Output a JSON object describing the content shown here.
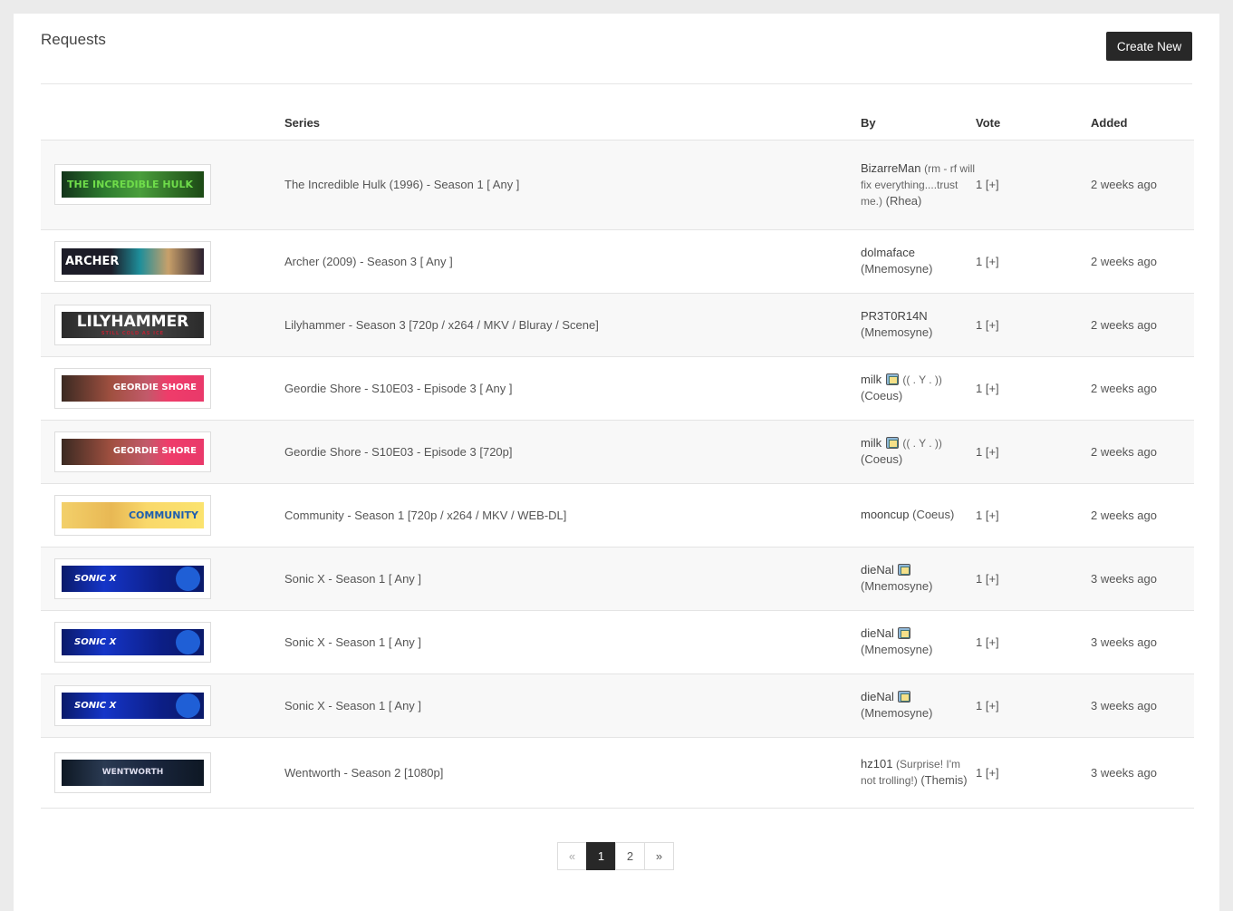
{
  "page": {
    "title": "Requests",
    "create_label": "Create New"
  },
  "table": {
    "headers": [
      "",
      "Series",
      "By",
      "Vote",
      "Added"
    ],
    "rows": [
      {
        "banner": "THE INCREDIBLE HULK",
        "banner_class": "b-hulk",
        "series": "The Incredible Hulk (1996) - Season 1 [ Any ]",
        "user": "BizarreMan",
        "note": "(rm - rf will fix everything....trust me.)",
        "tag": "(Rhea)",
        "tv": false,
        "vote": "1 [+]",
        "added": "2 weeks ago"
      },
      {
        "banner": "ARCHER",
        "banner_class": "b-archer",
        "series": "Archer (2009) - Season 3 [ Any ]",
        "user": "dolmaface",
        "note": "",
        "tag": "(Mnemosyne)",
        "tv": false,
        "vote": "1 [+]",
        "added": "2 weeks ago"
      },
      {
        "banner": "LILYHAMMER",
        "banner_sub": "STILL COLD AS ICE",
        "banner_class": "b-lily",
        "series": "Lilyhammer - Season 3 [720p / x264 / MKV / Bluray / Scene]",
        "user": "PR3T0R14N",
        "note": "",
        "tag": "(Mnemosyne)",
        "tv": false,
        "vote": "1 [+]",
        "added": "2 weeks ago"
      },
      {
        "banner": "GEORDIE SHORE",
        "banner_class": "b-geordie",
        "series": "Geordie Shore - S10E03 - Episode 3 [ Any ]",
        "user": "milk",
        "note": "(( . Y . ))",
        "tag": "(Coeus)",
        "tv": true,
        "vote": "1 [+]",
        "added": "2 weeks ago"
      },
      {
        "banner": "GEORDIE SHORE",
        "banner_class": "b-geordie",
        "series": "Geordie Shore - S10E03 - Episode 3 [720p]",
        "user": "milk",
        "note": "(( . Y . ))",
        "tag": "(Coeus)",
        "tv": true,
        "vote": "1 [+]",
        "added": "2 weeks ago"
      },
      {
        "banner": "COMMUNITY",
        "banner_class": "b-comm",
        "series": "Community - Season 1 [720p / x264 / MKV / WEB-DL]",
        "user": "mooncup",
        "note": "",
        "tag": "(Coeus)",
        "tv": false,
        "vote": "1 [+]",
        "added": "2 weeks ago"
      },
      {
        "banner": "SONIC X",
        "banner_class": "b-sonic",
        "series": "Sonic X - Season 1 [ Any ]",
        "user": "dieNal",
        "note": "",
        "tag": "(Mnemosyne)",
        "tv": true,
        "vote": "1 [+]",
        "added": "3 weeks ago"
      },
      {
        "banner": "SONIC X",
        "banner_class": "b-sonic",
        "series": "Sonic X - Season 1 [ Any ]",
        "user": "dieNal",
        "note": "",
        "tag": "(Mnemosyne)",
        "tv": true,
        "vote": "1 [+]",
        "added": "3 weeks ago"
      },
      {
        "banner": "SONIC X",
        "banner_class": "b-sonic",
        "series": "Sonic X - Season 1 [ Any ]",
        "user": "dieNal",
        "note": "",
        "tag": "(Mnemosyne)",
        "tv": true,
        "vote": "1 [+]",
        "added": "3 weeks ago"
      },
      {
        "banner": "WENTWORTH",
        "banner_class": "b-went",
        "series": "Wentworth - Season 2 [1080p]",
        "user": "hz101",
        "note": "(Surprise! I'm not trolling!)",
        "tag": "(Themis)",
        "tv": false,
        "vote": "1 [+]",
        "added": "3 weeks ago"
      }
    ]
  },
  "pagination": {
    "prev": "«",
    "pages": [
      "1",
      "2"
    ],
    "active": "1",
    "next": "»"
  }
}
